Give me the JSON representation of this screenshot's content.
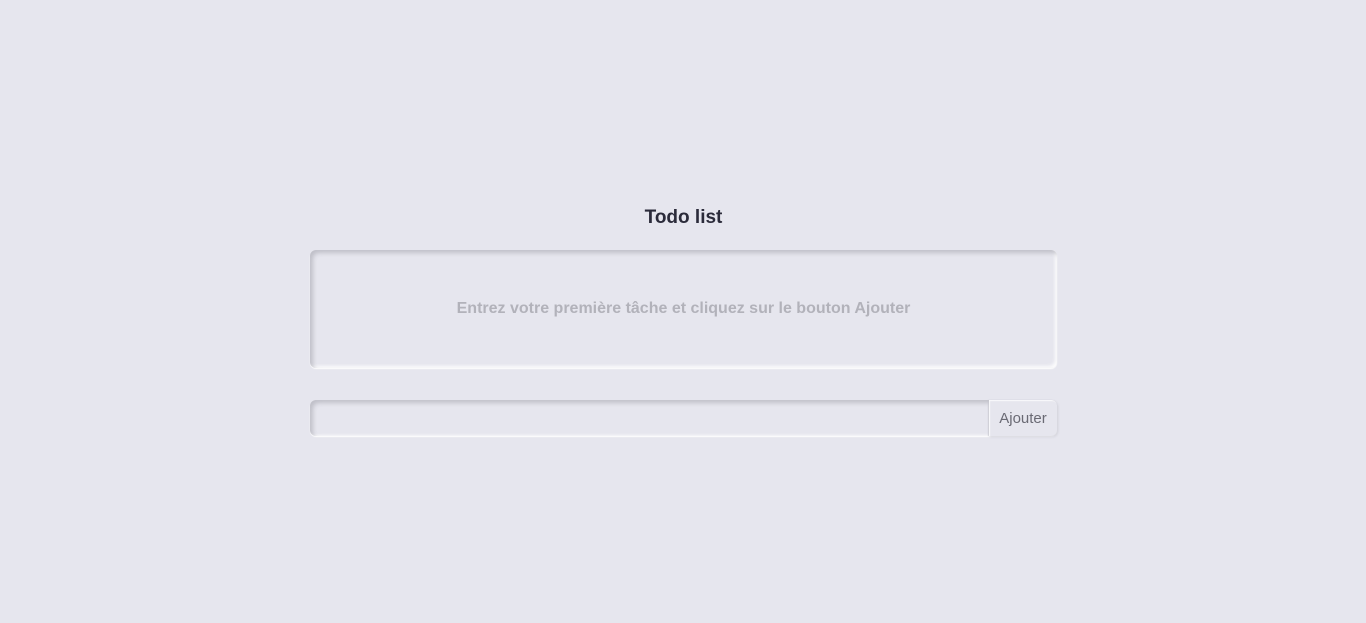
{
  "app": {
    "title": "Todo list"
  },
  "list": {
    "empty_message": "Entrez votre première tâche et cliquez sur le bouton Ajouter",
    "items": []
  },
  "new_task": {
    "value": "",
    "placeholder": "",
    "add_label": "Ajouter"
  },
  "colors": {
    "background": "#e6e6ee",
    "title": "#2b2b3a",
    "empty_message": "#b2b2ba",
    "button_text": "#6a6a74"
  }
}
